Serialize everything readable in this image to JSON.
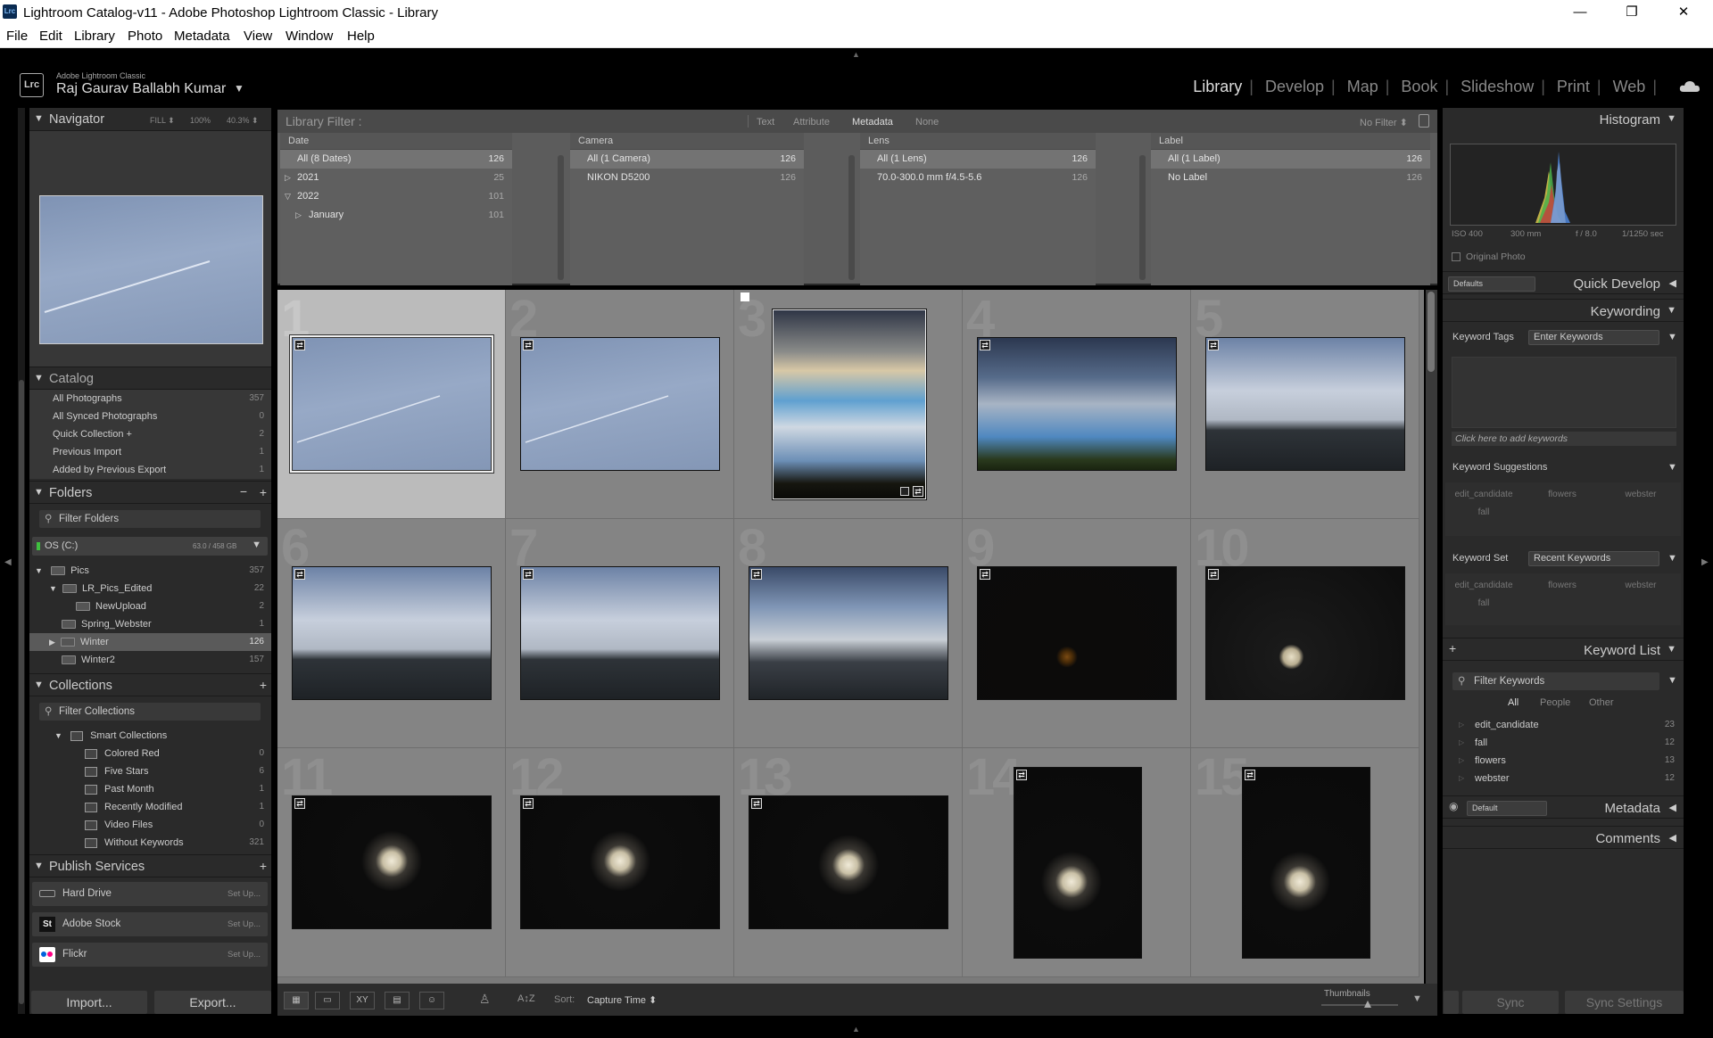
{
  "window": {
    "title": "Lightroom Catalog-v11 - Adobe Photoshop Lightroom Classic - Library",
    "app_icon": "Lrc",
    "minimize": "—",
    "maximize": "❐",
    "close": "✕"
  },
  "menu": [
    "File",
    "Edit",
    "Library",
    "Photo",
    "Metadata",
    "View",
    "Window",
    "Help"
  ],
  "identity": {
    "logo": "Lrc",
    "brand": "Adobe Lightroom Classic",
    "user": "Raj Gaurav Ballabh Kumar"
  },
  "modules": [
    "Library",
    "Develop",
    "Map",
    "Book",
    "Slideshow",
    "Print",
    "Web"
  ],
  "navigator": {
    "title": "Navigator",
    "fill": "FILL ⬍",
    "z100": "100%",
    "zoom": "40.3% ⬍"
  },
  "catalog": {
    "title": "Catalog",
    "items": [
      {
        "label": "All Photographs",
        "count": "357"
      },
      {
        "label": "All Synced Photographs",
        "count": "0"
      },
      {
        "label": "Quick Collection +",
        "count": "2"
      },
      {
        "label": "Previous Import",
        "count": "1"
      },
      {
        "label": "Added by Previous Export",
        "count": "1"
      }
    ]
  },
  "folders": {
    "title": "Folders",
    "filter": "Filter Folders",
    "volume": "OS (C:)",
    "volume_size": "63.0 / 458 GB",
    "items": [
      {
        "label": "Pics",
        "count": "357"
      },
      {
        "label": "LR_Pics_Edited",
        "count": "22"
      },
      {
        "label": "NewUpload",
        "count": "2"
      },
      {
        "label": "Spring_Webster",
        "count": "1"
      },
      {
        "label": "Winter",
        "count": "126"
      },
      {
        "label": "Winter2",
        "count": "157"
      }
    ]
  },
  "collections": {
    "title": "Collections",
    "filter": "Filter Collections",
    "smart": "Smart Collections",
    "items": [
      {
        "label": "Colored Red",
        "count": "0"
      },
      {
        "label": "Five Stars",
        "count": "6"
      },
      {
        "label": "Past Month",
        "count": "1"
      },
      {
        "label": "Recently Modified",
        "count": "1"
      },
      {
        "label": "Video Files",
        "count": "0"
      },
      {
        "label": "Without Keywords",
        "count": "321"
      }
    ]
  },
  "publish": {
    "title": "Publish Services",
    "setup": "Set Up...",
    "items": [
      {
        "label": "Hard Drive",
        "icon": "HD"
      },
      {
        "label": "Adobe Stock",
        "icon": "St"
      },
      {
        "label": "Flickr",
        "icon": "●●"
      }
    ]
  },
  "left_buttons": {
    "import": "Import...",
    "export": "Export..."
  },
  "library_filter": {
    "label": "Library Filter :",
    "tabs": [
      "Text",
      "Attribute",
      "Metadata",
      "None"
    ],
    "preset": "No Filter ⬍"
  },
  "browser": {
    "date": {
      "header": "Date",
      "rows": [
        {
          "label": "All (8 Dates)",
          "count": "126"
        },
        {
          "label": "2021",
          "count": "25"
        },
        {
          "label": "2022",
          "count": "101"
        },
        {
          "label": "January",
          "count": "101"
        }
      ]
    },
    "camera": {
      "header": "Camera",
      "rows": [
        {
          "label": "All (1 Camera)",
          "count": "126"
        },
        {
          "label": "NIKON D5200",
          "count": "126"
        }
      ]
    },
    "lens": {
      "header": "Lens",
      "rows": [
        {
          "label": "All (1 Lens)",
          "count": "126"
        },
        {
          "label": "70.0-300.0 mm f/4.5-5.6",
          "count": "126"
        }
      ]
    },
    "label": {
      "header": "Label",
      "rows": [
        {
          "label": "All (1 Label)",
          "count": "126"
        },
        {
          "label": "No Label",
          "count": "126"
        }
      ]
    }
  },
  "grid": {
    "cells": [
      "1",
      "2",
      "3",
      "4",
      "5",
      "6",
      "7",
      "8",
      "9",
      "10",
      "11",
      "12",
      "13",
      "14",
      "15"
    ],
    "badge": "⇄"
  },
  "toolbar": {
    "sort_label": "Sort:",
    "sort_value": "Capture Time ⬍",
    "thumbs_label": "Thumbnails",
    "grid_icon": "▦",
    "loupe_icon": "▭",
    "compare_icon": "XY",
    "survey_icon": "▤",
    "people_icon": "☺",
    "spray_icon": "♙",
    "az_icon": "A↕Z"
  },
  "histogram": {
    "title": "Histogram",
    "iso": "ISO 400",
    "focal": "300 mm",
    "aperture": "f / 8.0",
    "shutter": "1/1250 sec",
    "original": "Original Photo"
  },
  "quick_develop": {
    "title": "Quick Develop",
    "preset": "Defaults"
  },
  "keywording": {
    "title": "Keywording",
    "tags_label": "Keyword Tags",
    "tags_mode": "Enter Keywords",
    "click_hint": "Click here to add keywords",
    "suggestions_label": "Keyword Suggestions",
    "suggestions": [
      "edit_candidate",
      "flowers",
      "webster",
      "fall"
    ],
    "set_label": "Keyword Set",
    "set_value": "Recent Keywords",
    "set_items": [
      "edit_candidate",
      "flowers",
      "webster",
      "fall"
    ]
  },
  "keyword_list": {
    "title": "Keyword List",
    "filter": "Filter Keywords",
    "tabs": [
      "All",
      "People",
      "Other"
    ],
    "items": [
      {
        "label": "edit_candidate",
        "count": "23"
      },
      {
        "label": "fall",
        "count": "12"
      },
      {
        "label": "flowers",
        "count": "13"
      },
      {
        "label": "webster",
        "count": "12"
      }
    ]
  },
  "metadata": {
    "title": "Metadata",
    "preset": "Default"
  },
  "comments": {
    "title": "Comments"
  },
  "right_buttons": {
    "sync": "Sync",
    "sync_settings": "Sync Settings"
  }
}
